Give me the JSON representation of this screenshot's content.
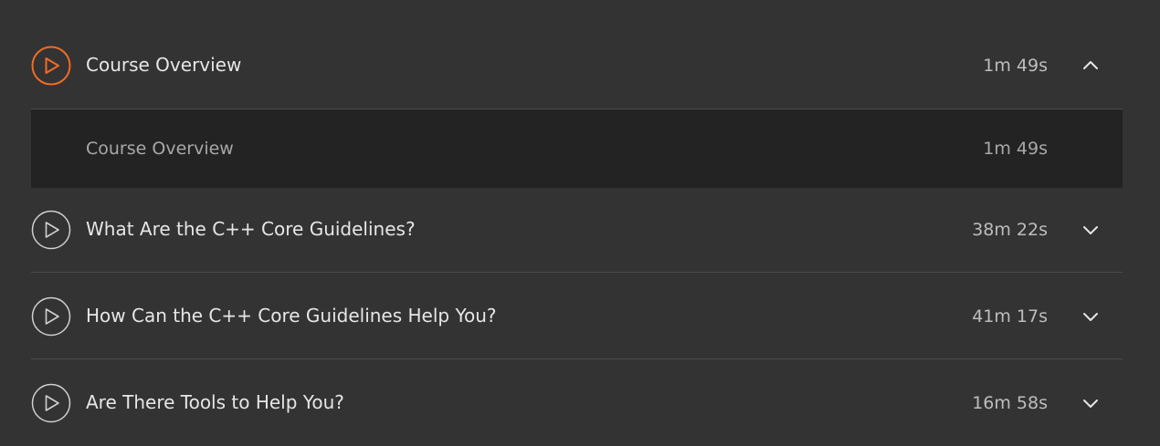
{
  "theme": {
    "background": "#333333",
    "expanded_background": "#232323",
    "accent": "#f26b24",
    "divider": "#4a4a4a",
    "icon_outline": "#cfcfcf"
  },
  "modules": [
    {
      "title": "Course Overview",
      "duration": "1m 49s",
      "expanded": true,
      "play_icon": "play-circle-icon",
      "chevron_icon": "chevron-up-icon",
      "clips": [
        {
          "title": "Course Overview",
          "duration": "1m 49s"
        }
      ]
    },
    {
      "title": "What Are the C++ Core Guidelines?",
      "duration": "38m 22s",
      "expanded": false,
      "play_icon": "play-circle-icon",
      "chevron_icon": "chevron-down-icon"
    },
    {
      "title": "How Can the C++ Core Guidelines Help You?",
      "duration": "41m 17s",
      "expanded": false,
      "play_icon": "play-circle-icon",
      "chevron_icon": "chevron-down-icon"
    },
    {
      "title": "Are There Tools to Help You?",
      "duration": "16m 58s",
      "expanded": false,
      "play_icon": "play-circle-icon",
      "chevron_icon": "chevron-down-icon"
    }
  ]
}
